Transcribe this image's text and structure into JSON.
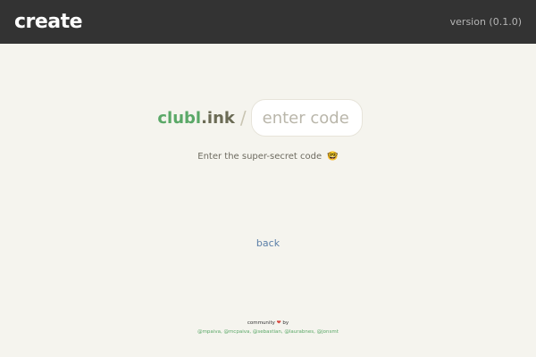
{
  "header": {
    "title": "create",
    "version": "version (0.1.0)"
  },
  "code_entry": {
    "brand_part1": "clubl",
    "brand_part2": ".ink",
    "slash": "/",
    "input_value": "",
    "input_placeholder": "enter code",
    "hint": "Enter the super-secret code",
    "hint_emoji": "🤓"
  },
  "nav": {
    "back_label": "back"
  },
  "footer": {
    "community_label": "community",
    "heart": "❤",
    "by_label": "by",
    "contributors": [
      "@mpaiva",
      "@mcpaiva",
      "@sebastian",
      "@laurabnes",
      "@jonsmt"
    ]
  },
  "colors": {
    "header_bg": "#333333",
    "page_bg": "#f5f4ee",
    "brand_green": "#5aa867",
    "link_blue": "#5b7fa8",
    "heart_red": "#d8453b"
  }
}
